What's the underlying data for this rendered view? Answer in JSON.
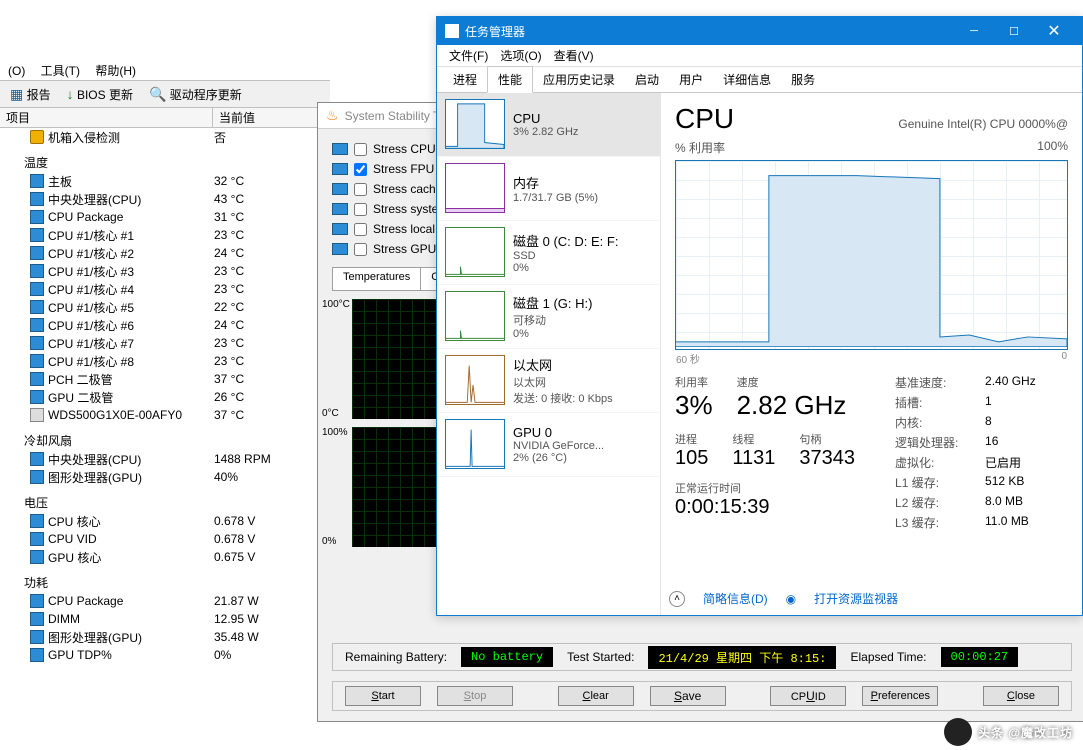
{
  "hwinfo": {
    "menu": {
      "tools": "工具(T)",
      "help": "帮助(H)",
      "other": "(O)"
    },
    "toolbar": {
      "report": "报告",
      "bios": "BIOS 更新",
      "driver": "驱动程序更新"
    },
    "header": {
      "item": "项目",
      "value": "当前值"
    },
    "intrusion": {
      "label": "机箱入侵检测",
      "value": "否"
    },
    "cat_temp": "温度",
    "temps": [
      {
        "label": "主板",
        "value": "32 °C"
      },
      {
        "label": "中央处理器(CPU)",
        "value": "43 °C"
      },
      {
        "label": "CPU Package",
        "value": "31 °C"
      },
      {
        "label": "CPU #1/核心 #1",
        "value": "23 °C"
      },
      {
        "label": "CPU #1/核心 #2",
        "value": "24 °C"
      },
      {
        "label": "CPU #1/核心 #3",
        "value": "23 °C"
      },
      {
        "label": "CPU #1/核心 #4",
        "value": "23 °C"
      },
      {
        "label": "CPU #1/核心 #5",
        "value": "22 °C"
      },
      {
        "label": "CPU #1/核心 #6",
        "value": "24 °C"
      },
      {
        "label": "CPU #1/核心 #7",
        "value": "23 °C"
      },
      {
        "label": "CPU #1/核心 #8",
        "value": "23 °C"
      },
      {
        "label": "PCH 二极管",
        "value": "37 °C"
      },
      {
        "label": "GPU 二极管",
        "value": "26 °C"
      },
      {
        "label": "WDS500G1X0E-00AFY0",
        "value": "37 °C",
        "drive": true
      }
    ],
    "cat_fan": "冷却风扇",
    "fans": [
      {
        "label": "中央处理器(CPU)",
        "value": "1488 RPM"
      },
      {
        "label": "图形处理器(GPU)",
        "value": "40%"
      }
    ],
    "cat_volt": "电压",
    "volts": [
      {
        "label": "CPU 核心",
        "value": "0.678 V"
      },
      {
        "label": "CPU VID",
        "value": "0.678 V"
      },
      {
        "label": "GPU 核心",
        "value": "0.675 V"
      }
    ],
    "cat_power": "功耗",
    "power": [
      {
        "label": "CPU Package",
        "value": "21.87 W"
      },
      {
        "label": "DIMM",
        "value": "12.95 W"
      },
      {
        "label": "图形处理器(GPU)",
        "value": "35.48 W"
      },
      {
        "label": "GPU TDP%",
        "value": "0%"
      }
    ]
  },
  "sst": {
    "title": "System Stability T",
    "checks": [
      {
        "label": "Stress CPU",
        "checked": false
      },
      {
        "label": "Stress FPU",
        "checked": true
      },
      {
        "label": "Stress cache",
        "checked": false
      },
      {
        "label": "Stress system",
        "checked": false
      },
      {
        "label": "Stress local d",
        "checked": false
      },
      {
        "label": "Stress GPU(s",
        "checked": false
      }
    ],
    "tab1": "Temperatures",
    "tab2": "Co",
    "g1_top": "100°C",
    "g1_bot": "0°C",
    "g2_top": "100%",
    "g2_bot": "0%",
    "footer": {
      "rb": "Remaining Battery:",
      "rb_v": "No battery",
      "ts": "Test Started:",
      "ts_v": "21/4/29 星期四 下午 8:15:",
      "et": "Elapsed Time:",
      "et_v": "00:00:27"
    },
    "btns": {
      "start": "Start",
      "stop": "Stop",
      "clear": "Clear",
      "save": "Save",
      "cpuid": "CPUID",
      "prefs": "Preferences",
      "close": "Close"
    }
  },
  "tm": {
    "title": "任务管理器",
    "menu": {
      "file": "文件(F)",
      "options": "选项(O)",
      "view": "查看(V)"
    },
    "tabs": {
      "proc": "进程",
      "perf": "性能",
      "hist": "应用历史记录",
      "startup": "启动",
      "users": "用户",
      "details": "详细信息",
      "services": "服务"
    },
    "sidebar": [
      {
        "key": "cpu",
        "t1": "CPU",
        "t2": "3% 2.82 GHz",
        "cls": "cpu"
      },
      {
        "key": "mem",
        "t1": "内存",
        "t2": "1.7/31.7 GB (5%)",
        "cls": "mem"
      },
      {
        "key": "disk0",
        "t1": "磁盘 0 (C: D: E: F:",
        "t2": "SSD",
        "t3": "0%",
        "cls": "disk"
      },
      {
        "key": "disk1",
        "t1": "磁盘 1 (G: H:)",
        "t2": "可移动",
        "t3": "0%",
        "cls": "disk"
      },
      {
        "key": "eth",
        "t1": "以太网",
        "t2": "以太网",
        "t3": "发送: 0 接收: 0 Kbps",
        "cls": "net"
      },
      {
        "key": "gpu",
        "t1": "GPU 0",
        "t2": "NVIDIA GeForce...",
        "t3": "2% (26 °C)",
        "cls": "gpu"
      }
    ],
    "main": {
      "title": "CPU",
      "model": "Genuine Intel(R) CPU 0000%@",
      "util_label": "% 利用率",
      "util_max": "100%",
      "xl_left": "60 秒",
      "xl_right": "0",
      "stats": {
        "util_k": "利用率",
        "util_v": "3%",
        "speed_k": "速度",
        "speed_v": "2.82 GHz",
        "proc_k": "进程",
        "proc_v": "105",
        "thr_k": "线程",
        "thr_v": "1131",
        "hnd_k": "句柄",
        "hnd_v": "37343",
        "up_k": "正常运行时间",
        "up_v": "0:00:15:39"
      },
      "right": {
        "base_k": "基准速度:",
        "base_v": "2.40 GHz",
        "sock_k": "插槽:",
        "sock_v": "1",
        "core_k": "内核:",
        "core_v": "8",
        "lp_k": "逻辑处理器:",
        "lp_v": "16",
        "virt_k": "虚拟化:",
        "virt_v": "已启用",
        "l1_k": "L1 缓存:",
        "l1_v": "512 KB",
        "l2_k": "L2 缓存:",
        "l2_v": "8.0 MB",
        "l3_k": "L3 缓存:",
        "l3_v": "11.0 MB"
      }
    },
    "bottom": {
      "brief": "简略信息(D)",
      "resmon": "打开资源监视器"
    }
  },
  "watermark": "头条 @魔改工坊"
}
